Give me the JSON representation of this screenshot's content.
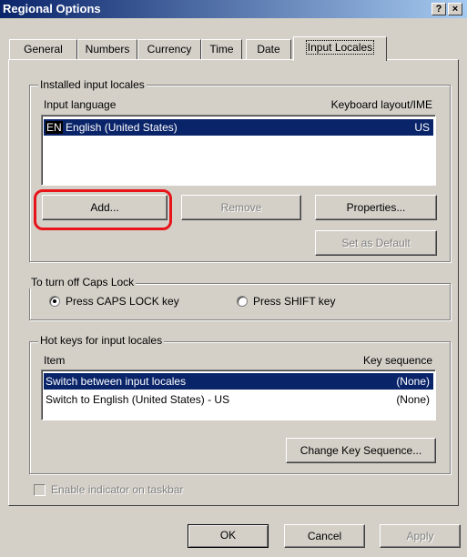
{
  "window": {
    "title": "Regional Options",
    "help_button": "?",
    "close_button": "×"
  },
  "tabs": [
    "General",
    "Numbers",
    "Currency",
    "Time",
    "Date",
    "Input Locales"
  ],
  "installed": {
    "group_label": "Installed input locales",
    "col_language": "Input language",
    "col_layout": "Keyboard layout/IME",
    "items": [
      {
        "badge": "EN",
        "language": "English (United States)",
        "layout": "US",
        "selected": true
      }
    ],
    "buttons": {
      "add": "Add...",
      "remove": "Remove",
      "properties": "Properties...",
      "set_default": "Set as Default"
    }
  },
  "caps_lock": {
    "group_label": "To turn off Caps Lock",
    "options": [
      {
        "label": "Press CAPS LOCK key",
        "checked": true
      },
      {
        "label": "Press SHIFT key",
        "checked": false
      }
    ]
  },
  "hotkeys": {
    "group_label": "Hot keys for input locales",
    "col_item": "Item",
    "col_sequence": "Key sequence",
    "rows": [
      {
        "item": "Switch between input locales",
        "sequence": "(None)",
        "selected": true
      },
      {
        "item": "Switch to English (United States) - US",
        "sequence": "(None)",
        "selected": false
      }
    ],
    "change_button": "Change Key Sequence..."
  },
  "indicator": {
    "label": "Enable indicator on taskbar",
    "checked": false,
    "enabled": false
  },
  "footer": {
    "ok": "OK",
    "cancel": "Cancel",
    "apply": "Apply"
  },
  "colors": {
    "title_bar_start": "#0a246a",
    "title_bar_end": "#a6caf0",
    "selection": "#0a246a",
    "highlight_ring": "#e8141a",
    "window_face": "#d4d0c8"
  }
}
